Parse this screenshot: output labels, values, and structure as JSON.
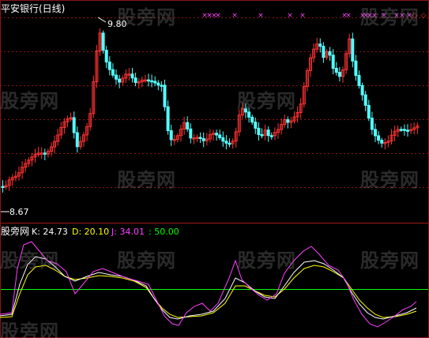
{
  "top_panel": {
    "title": "平安银行(日线)",
    "high_label": "9.80",
    "low_label": "8.67",
    "title_color": "#ffffff",
    "up_color": "#ff3232",
    "down_color": "#54ffff",
    "marker_color": "#ff40ff"
  },
  "kdj_panel": {
    "name": "股旁网",
    "k_text": "K: 24.73",
    "d_text": "D: 20.10",
    "j_text": "J: 34.01",
    "ref_text": ": 50.00",
    "k_color": "#ffffff",
    "d_color": "#ffff00",
    "j_color": "#ff40ff",
    "ref_color": "#00ff00"
  },
  "watermark": "股旁网",
  "chart_data": {
    "type": "candlestick",
    "price_range": [
      8.67,
      9.8
    ],
    "kdj_series": [
      {
        "name": "K",
        "value": 24.73
      },
      {
        "name": "D",
        "value": 20.1
      },
      {
        "name": "J",
        "value": 34.01
      }
    ],
    "reference_line": 50.0
  }
}
